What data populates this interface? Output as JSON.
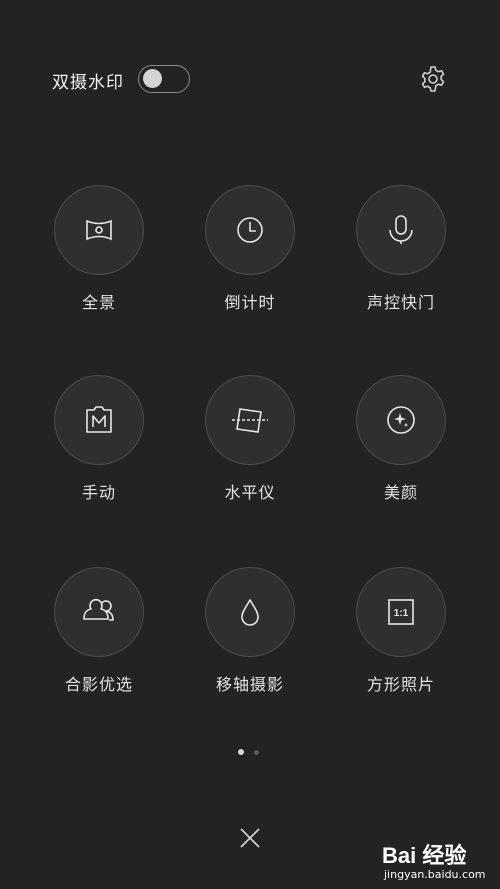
{
  "header": {
    "watermark_label": "双摄水印",
    "watermark_toggle_on": false
  },
  "modes": [
    {
      "label": "全景",
      "icon": "panorama-icon"
    },
    {
      "label": "倒计时",
      "icon": "timer-icon"
    },
    {
      "label": "声控快门",
      "icon": "voice-shutter-icon"
    },
    {
      "label": "手动",
      "icon": "manual-icon"
    },
    {
      "label": "水平仪",
      "icon": "level-icon"
    },
    {
      "label": "美颜",
      "icon": "beauty-icon"
    },
    {
      "label": "合影优选",
      "icon": "group-photo-icon"
    },
    {
      "label": "移轴摄影",
      "icon": "tilt-shift-icon"
    },
    {
      "label": "方形照片",
      "icon": "square-photo-icon"
    }
  ],
  "square_icon_text": "1:1",
  "pager": {
    "pages": 2,
    "current": 1
  },
  "watermark": {
    "brand": "Bai 经验",
    "url": "jingyan.baidu.com"
  }
}
